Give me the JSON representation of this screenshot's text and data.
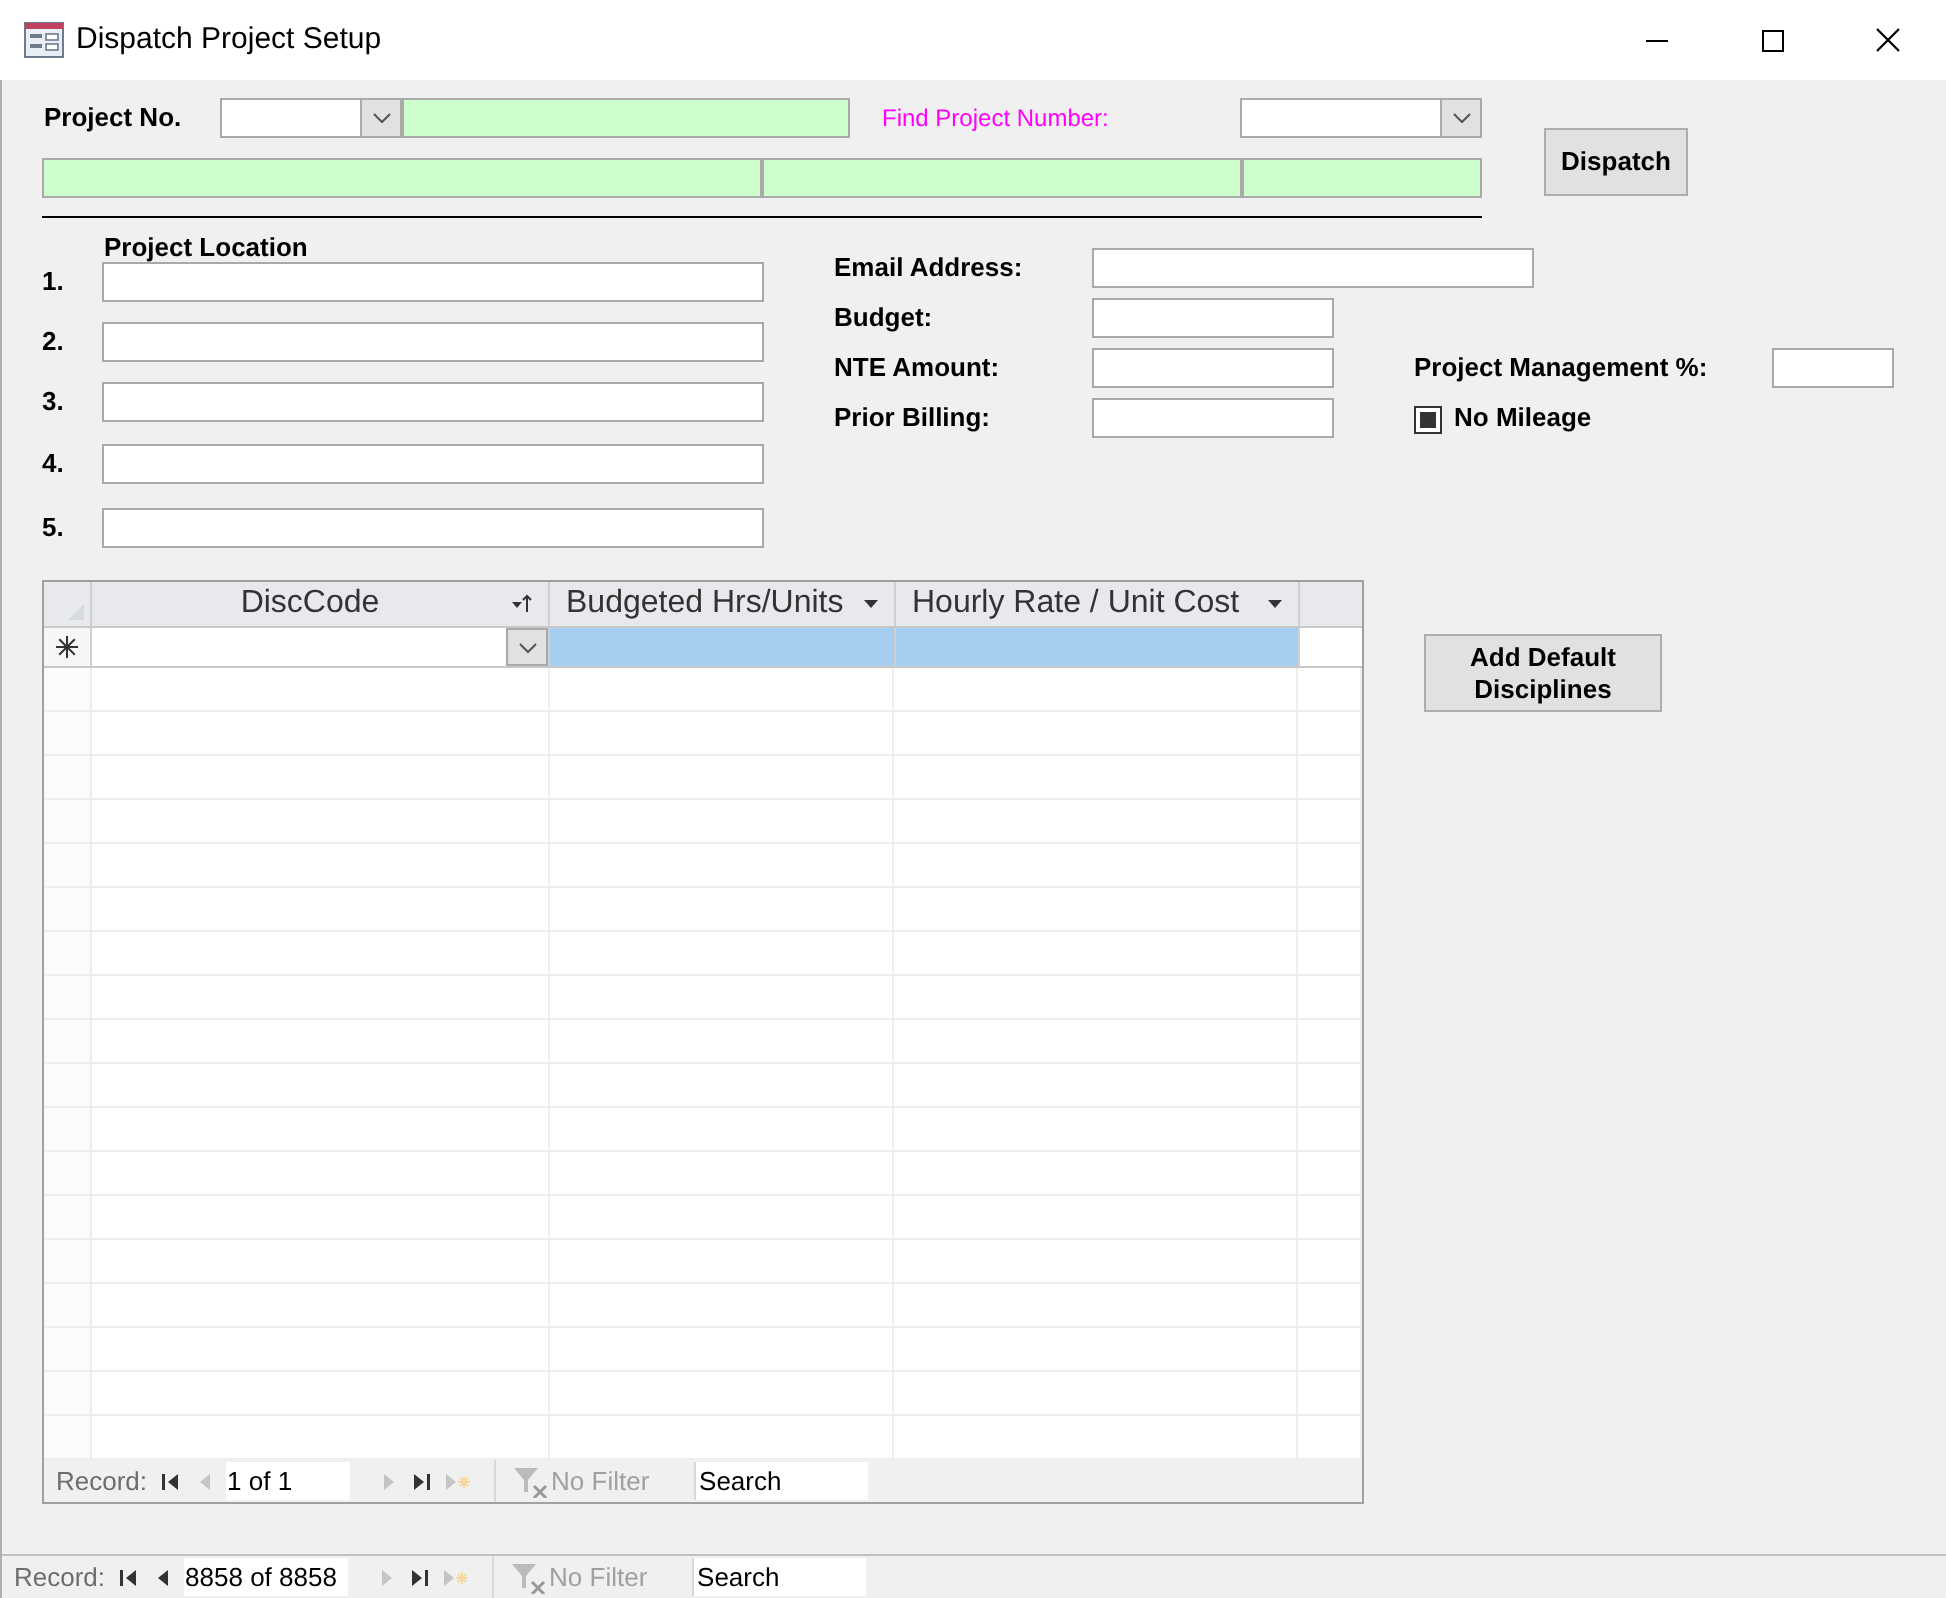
{
  "window": {
    "title": "Dispatch Project Setup"
  },
  "header": {
    "project_no_label": "Project No.",
    "find_label": "Find Project Number:",
    "dispatch_button": "Dispatch"
  },
  "location": {
    "title": "Project Location",
    "rows": [
      "1.",
      "2.",
      "3.",
      "4.",
      "5."
    ]
  },
  "fields": [
    {
      "label": "Email Address:",
      "kind": "wide"
    },
    {
      "label": "Budget:",
      "kind": "short"
    },
    {
      "label": "NTE Amount:",
      "kind": "short"
    },
    {
      "label": "Prior Billing:",
      "kind": "short"
    }
  ],
  "project_management": {
    "label": "Project Management %:"
  },
  "no_mileage": {
    "label": "No Mileage",
    "indeterminate": true
  },
  "datasheet": {
    "columns": [
      {
        "label": "DiscCode",
        "sorted": true
      },
      {
        "label": "Budgeted Hrs/Units",
        "sorted": false
      },
      {
        "label": "Hourly Rate / Unit Cost",
        "sorted": false
      }
    ],
    "new_row": [
      {
        "kind": "combo",
        "selected": false
      },
      {
        "kind": "text",
        "selected": true
      },
      {
        "kind": "text",
        "selected": true
      }
    ],
    "navigation": {
      "label": "Record:",
      "position": "1 of 1",
      "filter": "No Filter",
      "search": {
        "placeholder": "Search"
      },
      "buttons": [
        {
          "kind": "first",
          "disabled": false
        },
        {
          "kind": "prev",
          "disabled": true
        },
        {
          "kind": "next",
          "disabled": true
        },
        {
          "kind": "last",
          "disabled": false
        },
        {
          "kind": "new",
          "disabled": true
        }
      ]
    }
  },
  "add_defaults_button": "Add Default Disciplines",
  "form_navigation": {
    "label": "Record:",
    "position": "8858 of 8858",
    "filter": "No Filter",
    "search": {
      "placeholder": "Search"
    },
    "buttons": [
      {
        "kind": "first",
        "disabled": false
      },
      {
        "kind": "prev",
        "disabled": false
      },
      {
        "kind": "next",
        "disabled": true
      },
      {
        "kind": "last",
        "disabled": false
      },
      {
        "kind": "new",
        "disabled": true
      }
    ]
  }
}
